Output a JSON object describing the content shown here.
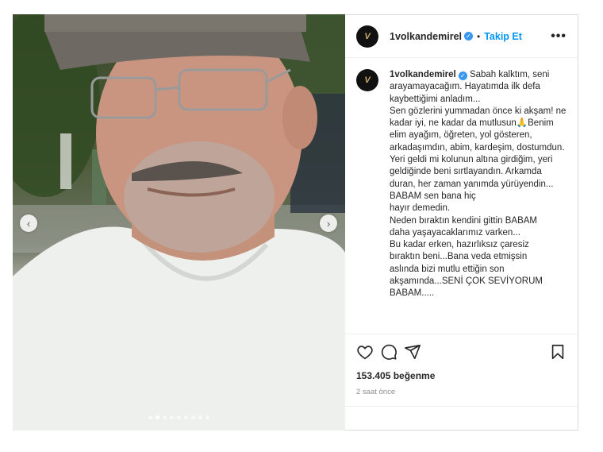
{
  "post": {
    "username": "1volkandemirel",
    "avatar_initials": "V",
    "separator": "•",
    "follow_label": "Takip Et",
    "more_label": "•••",
    "verified_icon": "✓",
    "caption": "Sabah kalktım, seni arayamayacağım. Hayatımda ilk defa kaybettiğimi anladım...\nSen gözlerini yummadan önce ki akşam! ne kadar iyi, ne kadar da mutlusun🙏Benim elim ayağım, öğreten, yol gösteren, arkadaşımdın, abim, kardeşim, dostumdun. Yeri geldi mi kolunun altına girdiğim, yeri geldiğinde beni sırtlayandın. Arkamda duran, her zaman yanımda yürüyendin...\nBABAM sen bana hiç\nhayır demedin.\nNeden bıraktın kendini gittin BABAM\ndaha yaşayacaklarımız varken...\nBu kadar erken, hazırlıksız çaresiz\nbıraktın beni...Bana veda etmişsin\naslında bizi mutlu ettiğin son\nakşamında...SENİ ÇOK SEVİYORUM\nBABAM.....",
    "likes": "153.405 beğenme",
    "time_ago": "2 saat önce"
  },
  "carousel": {
    "prev_label": "‹",
    "next_label": "›",
    "dot_count": 9,
    "active_dot": 1
  },
  "icons": [
    "heart-icon",
    "comment-icon",
    "share-icon",
    "bookmark-icon",
    "chevron-left-icon",
    "chevron-right-icon",
    "verified-icon",
    "more-icon"
  ],
  "colors": {
    "accent": "#0095f6",
    "verified": "#3897f0",
    "muted": "#8e8e8e"
  }
}
